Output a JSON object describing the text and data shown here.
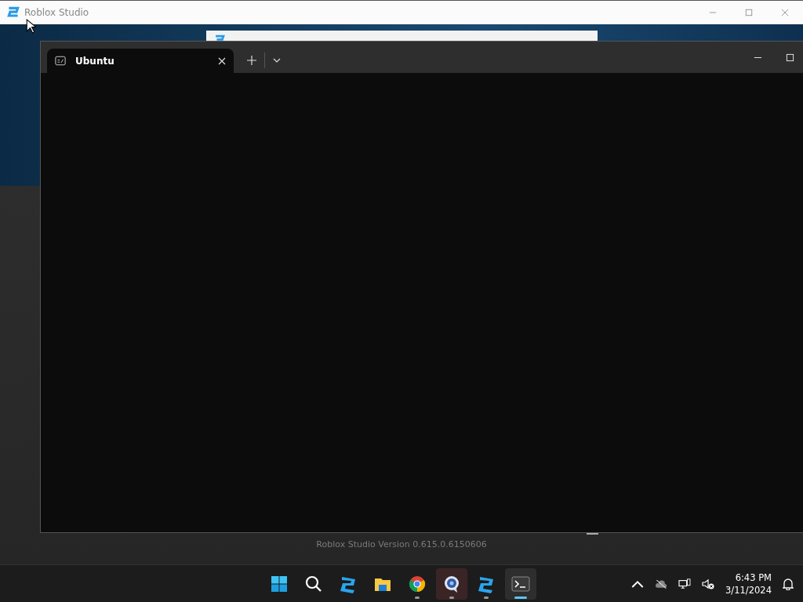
{
  "background_window": {
    "title": "Roblox Studio",
    "version_text": "Roblox Studio Version 0.615.0.6150606"
  },
  "terminal": {
    "tabs": [
      {
        "label": "Ubuntu",
        "selected": true
      }
    ]
  },
  "taskbar": {
    "apps": [
      {
        "kind": "start",
        "running": false,
        "selected": false
      },
      {
        "kind": "search",
        "running": false,
        "selected": false
      },
      {
        "kind": "roblox",
        "running": false,
        "selected": false
      },
      {
        "kind": "folder",
        "running": false,
        "selected": false
      },
      {
        "kind": "chrome",
        "running": true,
        "selected": false
      },
      {
        "kind": "camera",
        "running": true,
        "selected": false
      },
      {
        "kind": "roblox",
        "running": true,
        "selected": false
      },
      {
        "kind": "terminal",
        "running": true,
        "selected": true
      }
    ],
    "clock": {
      "time": "6:43 PM",
      "date": "3/11/2024"
    }
  }
}
